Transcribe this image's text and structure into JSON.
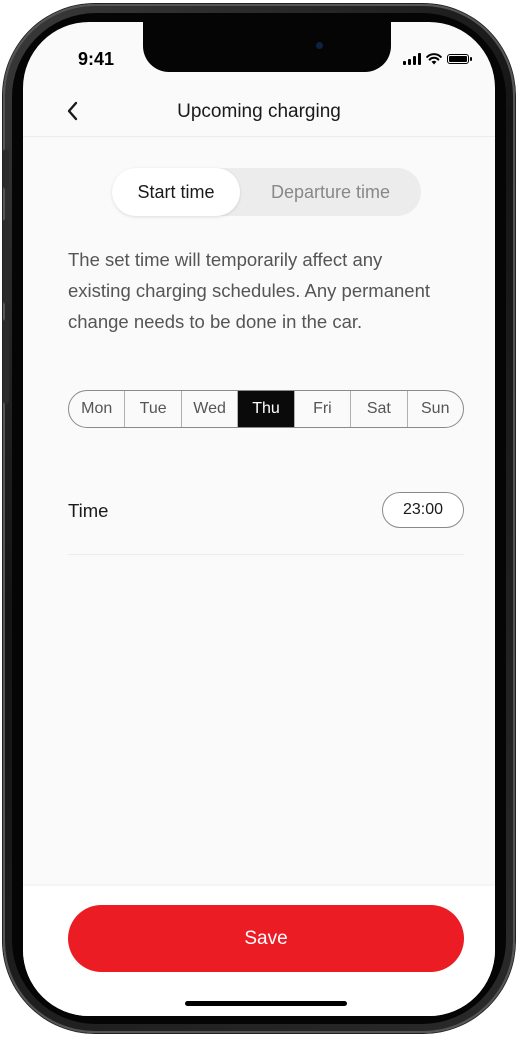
{
  "status_bar": {
    "time": "9:41"
  },
  "header": {
    "title": "Upcoming charging",
    "back_icon": "chevron-left-icon"
  },
  "segmented": {
    "start_label": "Start time",
    "departure_label": "Departure time",
    "selected": "start"
  },
  "description": "The set time will temporarily affect any existing charging schedules. Any permanent change needs to be done in the car.",
  "days": [
    {
      "label": "Mon",
      "selected": false
    },
    {
      "label": "Tue",
      "selected": false
    },
    {
      "label": "Wed",
      "selected": false
    },
    {
      "label": "Thu",
      "selected": true
    },
    {
      "label": "Fri",
      "selected": false
    },
    {
      "label": "Sat",
      "selected": false
    },
    {
      "label": "Sun",
      "selected": false
    }
  ],
  "time_row": {
    "label": "Time",
    "value": "23:00"
  },
  "footer": {
    "save_label": "Save"
  },
  "colors": {
    "accent": "#eb1c24",
    "selected_day_bg": "#0a0a0a"
  }
}
